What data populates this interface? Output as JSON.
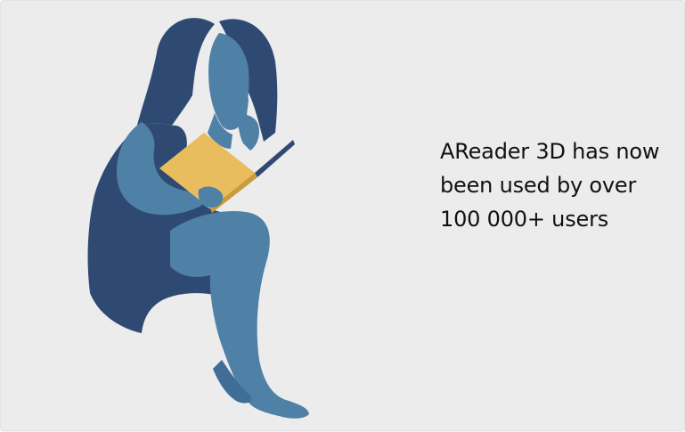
{
  "caption": {
    "line1": "AReader 3D has now",
    "line2": "been used by over",
    "line3": "100 000+ users"
  },
  "colors": {
    "background": "#ececec",
    "dark_blue": "#2f4a72",
    "light_blue": "#4f80a6",
    "book": "#e9bd5d",
    "text": "#111111"
  },
  "illustration": {
    "icon": "woman-reading-book-icon"
  }
}
